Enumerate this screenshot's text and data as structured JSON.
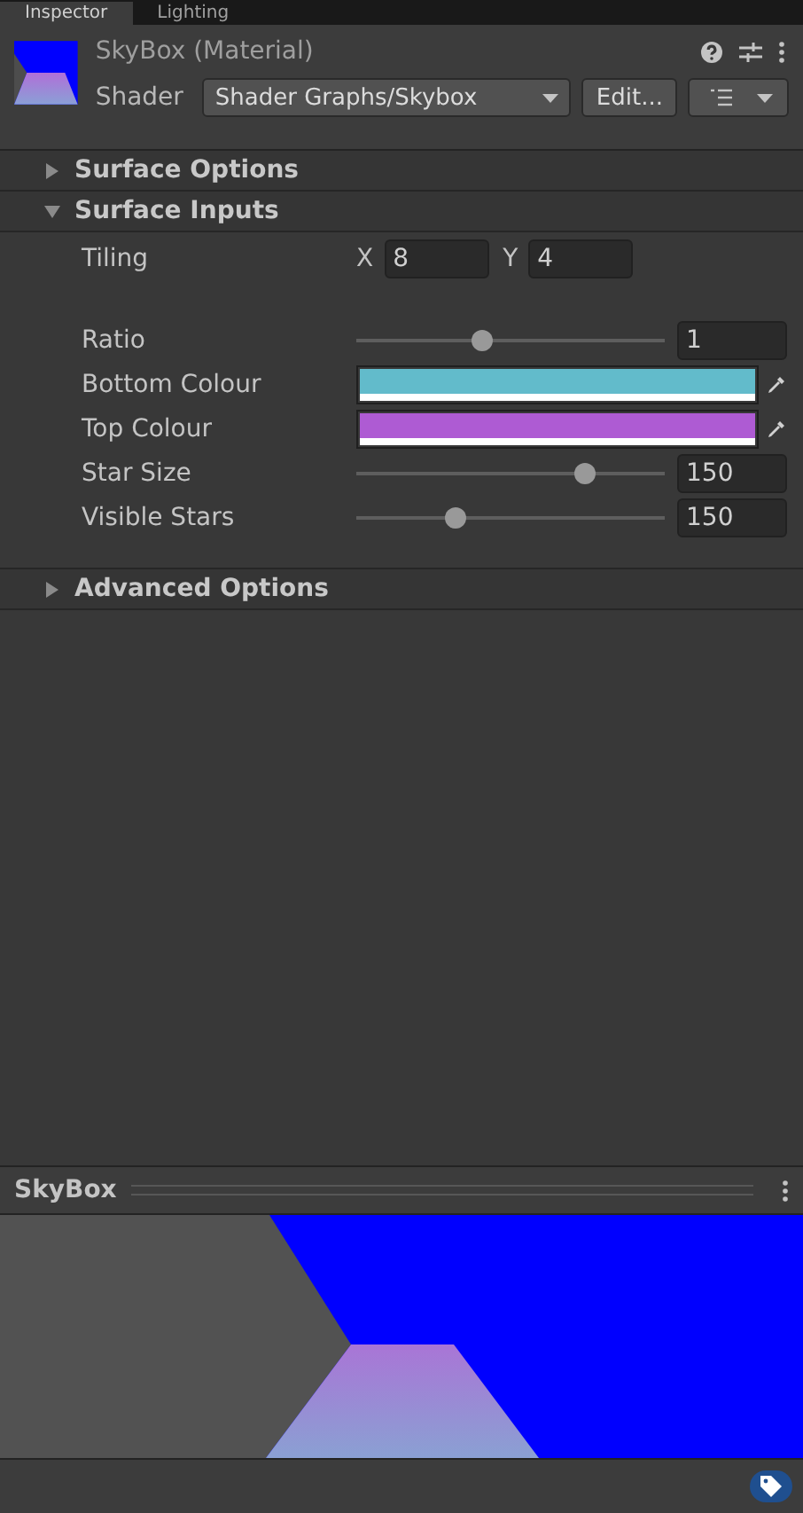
{
  "tabs": [
    {
      "label": "Inspector",
      "selected": true
    },
    {
      "label": "Lighting",
      "selected": false
    }
  ],
  "material": {
    "title": "SkyBox (Material)",
    "shader_label": "Shader",
    "shader": "Shader Graphs/Skybox",
    "edit_button": "Edit..."
  },
  "sections": [
    {
      "title": "Surface Options",
      "expanded": false
    },
    {
      "title": "Surface Inputs",
      "expanded": true,
      "properties": [
        {
          "kind": "vector",
          "label": "Tiling",
          "fields": [
            {
              "axis": "X",
              "value": "8"
            },
            {
              "axis": "Y",
              "value": "4"
            }
          ]
        },
        {
          "kind": "spacer"
        },
        {
          "kind": "slider",
          "label": "Ratio",
          "level": 0.41,
          "value": "1"
        },
        {
          "kind": "color",
          "label": "Bottom Colour",
          "color": "#62bbcb"
        },
        {
          "kind": "color",
          "label": "Top Colour",
          "color": "#ae5bd3"
        },
        {
          "kind": "slider",
          "label": "Star Size",
          "level": 0.74,
          "value": "150"
        },
        {
          "kind": "slider",
          "label": "Visible Stars",
          "level": 0.32,
          "value": "150"
        }
      ]
    },
    {
      "title": "Advanced Options",
      "expanded": false
    }
  ],
  "preview": {
    "title": "SkyBox",
    "kind": "picture"
  }
}
